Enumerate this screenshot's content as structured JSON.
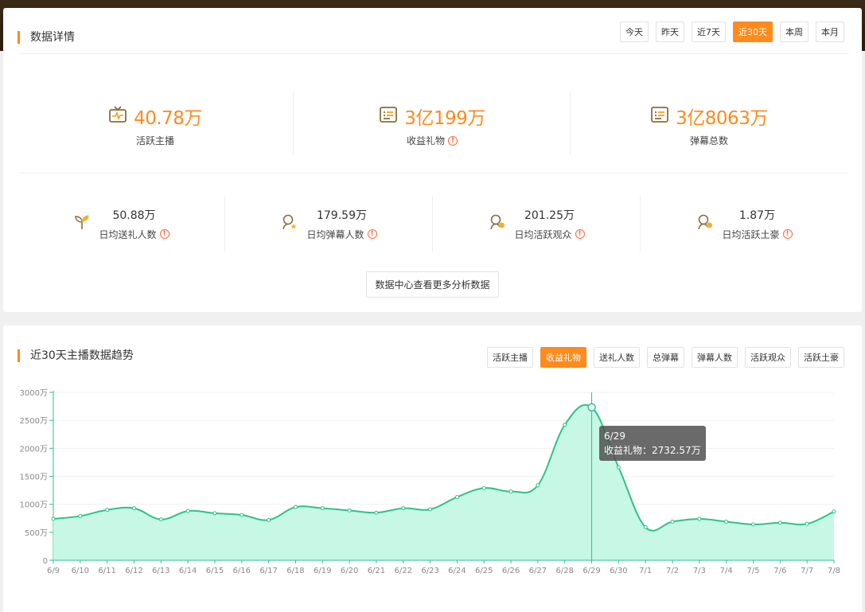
{
  "header": {
    "title": "数据详情",
    "range_tabs": [
      "今天",
      "昨天",
      "近7天",
      "近30天",
      "本周",
      "本月"
    ],
    "active_range": 3
  },
  "summary": {
    "big": [
      {
        "value": "40.78万",
        "label": "活跃主播",
        "info": false,
        "icon": "tv-icon"
      },
      {
        "value": "3亿199万",
        "label": "收益礼物",
        "info": true,
        "icon": "list-icon"
      },
      {
        "value": "3亿8063万",
        "label": "弹幕总数",
        "info": false,
        "icon": "list-icon"
      }
    ],
    "small": [
      {
        "value": "50.88万",
        "label": "日均送礼人数",
        "icon": "sprout-icon"
      },
      {
        "value": "179.59万",
        "label": "日均弹幕人数",
        "icon": "user-star-icon"
      },
      {
        "value": "201.25万",
        "label": "日均活跃观众",
        "icon": "users-icon"
      },
      {
        "value": "1.87万",
        "label": "日均活跃土豪",
        "icon": "users-icon"
      }
    ],
    "info_glyph": "!",
    "more_button": "数据中心查看更多分析数据"
  },
  "trend": {
    "title": "近30天主播数据趋势",
    "metric_tabs": [
      "活跃主播",
      "收益礼物",
      "送礼人数",
      "总弹幕",
      "弹幕人数",
      "活跃观众",
      "活跃土豪"
    ],
    "active_metric": 1,
    "tooltip": {
      "date": "6/29",
      "text": "收益礼物：2732.57万"
    }
  },
  "colors": {
    "accent": "#ff8a1d",
    "line": "#2ec28b",
    "area": "#c4f7e4"
  },
  "chart_data": {
    "type": "area",
    "x": [
      "6/9",
      "6/10",
      "6/11",
      "6/12",
      "6/13",
      "6/14",
      "6/15",
      "6/16",
      "6/17",
      "6/18",
      "6/19",
      "6/20",
      "6/21",
      "6/22",
      "6/23",
      "6/24",
      "6/25",
      "6/26",
      "6/27",
      "6/28",
      "6/29",
      "6/30",
      "7/1",
      "7/2",
      "7/3",
      "7/4",
      "7/5",
      "7/6",
      "7/7",
      "7/8"
    ],
    "series": [
      {
        "values": [
          740,
          790,
          900,
          930,
          730,
          880,
          840,
          810,
          720,
          950,
          930,
          890,
          850,
          930,
          910,
          1130,
          1290,
          1230,
          1340,
          2420,
          2733,
          1660,
          590,
          690,
          740,
          690,
          640,
          670,
          650,
          870
        ]
      }
    ],
    "ylim": [
      0,
      3000
    ],
    "yticks": [
      0,
      500,
      1000,
      1500,
      2000,
      2500,
      3000
    ],
    "ytick_labels": [
      "0",
      "500万",
      "1000万",
      "1500万",
      "2000万",
      "2500万",
      "3000万"
    ],
    "highlight_index": 20,
    "grid": true
  }
}
